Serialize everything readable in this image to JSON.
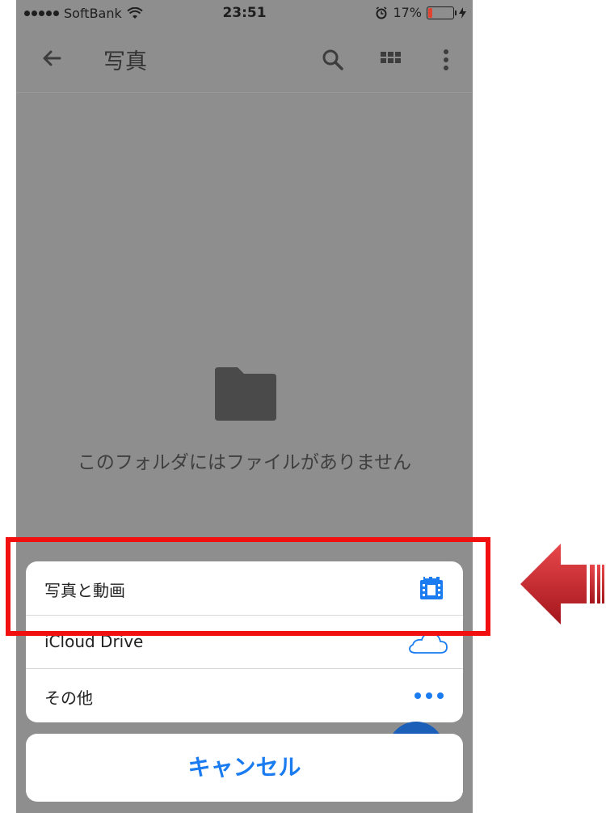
{
  "status_bar": {
    "carrier": "SoftBank",
    "time": "23:51",
    "battery_percent": "17%"
  },
  "app_bar": {
    "title": "写真",
    "icons": [
      "back-arrow-icon",
      "search-icon",
      "grid-view-icon",
      "more-vertical-icon"
    ]
  },
  "empty_state": {
    "message": "このフォルダにはファイルがありません",
    "icon": "folder-icon"
  },
  "action_sheet": {
    "items": [
      {
        "label": "写真と動画",
        "icon": "photo-library-icon",
        "icon_color": "#1a7cf0"
      },
      {
        "label": "iCloud Drive",
        "icon": "cloud-icon",
        "icon_color": "#1a7cf0"
      },
      {
        "label": "その他",
        "icon": "ellipsis-icon",
        "icon_color": "#1a7cf0"
      }
    ],
    "cancel_label": "キャンセル"
  },
  "colors": {
    "accent": "#1a7cf0",
    "highlight_border": "#f20f0f",
    "arrow": "#c0262c",
    "overlay_background": "#8e8e8e"
  }
}
